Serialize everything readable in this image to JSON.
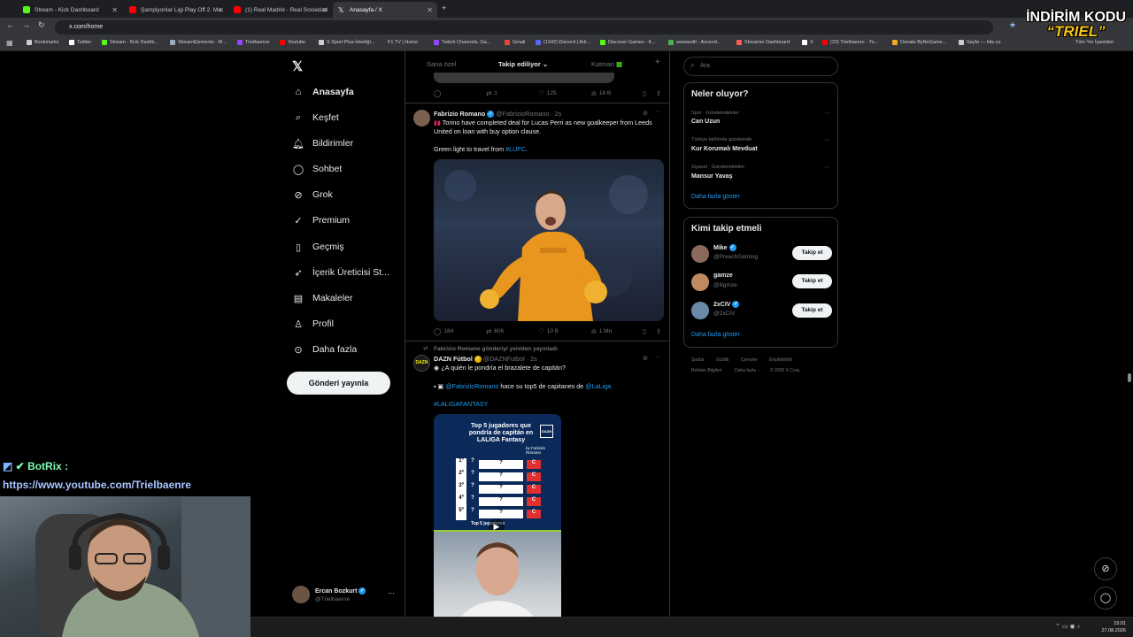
{
  "browser": {
    "tabs": [
      {
        "title": "Stream - Kick Dashboard",
        "color": "#53fc18"
      },
      {
        "title": "Şampiyonlar Ligi Play Off 2. Ma",
        "color": "#ff0000"
      },
      {
        "title": "(1) Real Madrid - Real Sociedad",
        "color": "#ff0000"
      },
      {
        "title": "Anasayfa / X",
        "color": "#ffffff"
      }
    ],
    "url": "x.com/home",
    "bookmarks": [
      "Bookmarks",
      "Twitter",
      "Stream - Kick Dashb...",
      "StreamElements - M...",
      "Trielbaenre",
      "Youtube",
      "S Sport Plus-İstediği...",
      "F1 TV | Home",
      "Twitch Channels, Ga...",
      "Gmail",
      "(1342) Discord | Ark...",
      "Discover Games - K...",
      "wowaudit - Ascend...",
      "Streamer Dashboard",
      "X",
      "(23) Trielbaenre - Yo...",
      "Donate ByNoGame...",
      "Sayfa — hits.co"
    ],
    "all_bookmarks": "Tüm Yer İşaretleri"
  },
  "overlay": {
    "line1": "İNDİRİM KODU",
    "code": "“TRIEL”"
  },
  "nav": {
    "items": [
      {
        "label": "Anasayfa",
        "icon": "home-icon"
      },
      {
        "label": "Keşfet",
        "icon": "search-icon"
      },
      {
        "label": "Bildirimler",
        "icon": "bell-icon"
      },
      {
        "label": "Sohbet",
        "icon": "chat-icon"
      },
      {
        "label": "Grok",
        "icon": "grok-icon"
      },
      {
        "label": "Premium",
        "icon": "premium-icon"
      },
      {
        "label": "Geçmiş",
        "icon": "bookmark-icon"
      },
      {
        "label": "İçerik Üreticisi St...",
        "icon": "rocket-icon"
      },
      {
        "label": "Makaleler",
        "icon": "article-icon"
      },
      {
        "label": "Profil",
        "icon": "profile-icon"
      },
      {
        "label": "Daha fazla",
        "icon": "more-icon"
      }
    ],
    "post_button": "Gönderi yayınla",
    "account": {
      "name": "Ercan Bozkurt",
      "handle": "@Trielbaenre"
    }
  },
  "feed": {
    "tabs": [
      "Sana özel",
      "Takip ediliyor",
      "Katman"
    ],
    "prev_tweet_actions": {
      "replies": "",
      "retweets": "1",
      "likes": "125",
      "views": "18 B"
    },
    "tweet1": {
      "author": "Fabrizio Romano",
      "handle": "@FabrizioRomano",
      "time": "2s",
      "text1": "Torino have completed deal for Lucas Perri as new goalkeeper from Leeds United on loan with buy option clause.",
      "text2_prefix": "Green light to travel from ",
      "hashtag": "#LUFC",
      "text2_suffix": ".",
      "actions": {
        "replies": "184",
        "retweets": "606",
        "likes": "10 B",
        "views": "1 Mn"
      }
    },
    "tweet2": {
      "retweeted_by": "Fabrizio Romano gönderiyi yeniden yayınladı",
      "author": "DAZN Fútbol",
      "handle": "@DAZNFutbol",
      "time": "2s",
      "line1": "¿A quién le pondría el brazalete de capitán?",
      "mention1": "@FabrizioRomano",
      "line2_mid": " hace su top5 de capitanes de ",
      "mention2": "@LaLiga",
      "hashtag": "#LALIGAFANTASY",
      "graphic_title": "Top 5 jugadores que pondría de capitán en LALIGA Fantasy",
      "graphic_by": "by Fabrizio Romano",
      "graphic_caption": "Top 5 jugadores",
      "graphic_ranks": [
        "1º",
        "2º",
        "3º",
        "4º",
        "5º"
      ],
      "graphic_q": "?",
      "graphic_c": "C",
      "dazn_logo": "DAZN"
    }
  },
  "sidebar": {
    "search_placeholder": "Ara",
    "trends_title": "Neler oluyor?",
    "trends": [
      {
        "category": "Spor · Gündemdekiler",
        "name": "Can Uzun"
      },
      {
        "category": "Türkiye tarihinde gündemde",
        "name": "Kur Korumalı Mevduat"
      },
      {
        "category": "Siyaset · Gündemdekiler",
        "name": "Mansur Yavaş"
      }
    ],
    "trends_more": "Daha fazla göster",
    "follow_title": "Kimi takip etmeli",
    "suggestions": [
      {
        "name": "Mike",
        "handle": "@PreachGaming",
        "verified": true
      },
      {
        "name": "gamze",
        "handle": "@lilgmze",
        "verified": false
      },
      {
        "name": "2xCIV",
        "handle": "@2xCIV",
        "verified": true
      }
    ],
    "follow_label": "Takip et",
    "follow_more": "Daha fazla göster",
    "footer": [
      "Şartlar",
      "Gizlilik",
      "Çerezler",
      "Erişilebilirlik",
      "Reklam Bilgileri",
      "Daha fazla ···",
      "© 2026 X Corp."
    ]
  },
  "stream": {
    "botrix_name": "BotRix :",
    "botrix_url": "https://www.youtube.com/Trielbaenre"
  },
  "taskbar": {
    "time": "19:01",
    "date": "27.08.2026"
  }
}
